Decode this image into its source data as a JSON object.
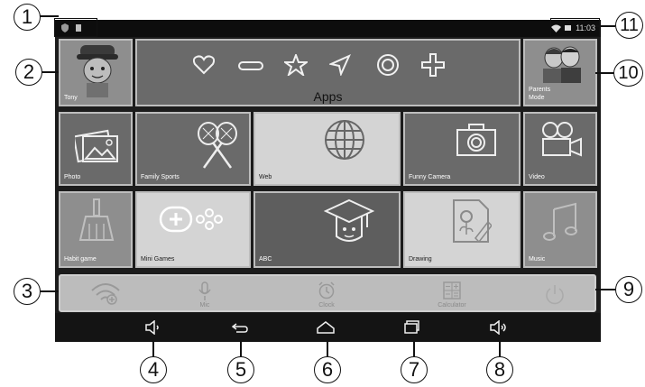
{
  "status_bar": {
    "time": "11:03",
    "left_icons": [
      "shield-icon",
      "battery-small-icon"
    ],
    "right_icons": [
      "wifi-icon",
      "battery-icon"
    ]
  },
  "profile": {
    "name": "Tony"
  },
  "apps_banner": {
    "label": "Apps"
  },
  "parents_mode": {
    "label": "Parents Mode"
  },
  "tiles": [
    {
      "label": "Photo"
    },
    {
      "label": "Family Sports"
    },
    {
      "label": "Web"
    },
    {
      "label": "Funny Camera"
    },
    {
      "label": "Video"
    },
    {
      "label": "Habit game"
    },
    {
      "label": "Mini Games"
    },
    {
      "label": "ABC"
    },
    {
      "label": "Drawing"
    },
    {
      "label": "Music"
    }
  ],
  "dock": {
    "wifi": {
      "label": ""
    },
    "mic": {
      "label": "Mic"
    },
    "clock": {
      "label": "Clock"
    },
    "calculator": {
      "label": "Calculator"
    },
    "power": {
      "label": ""
    }
  },
  "nav": [
    "volume-down-icon",
    "back-icon",
    "home-icon",
    "recent-apps-icon",
    "volume-up-icon"
  ],
  "callouts": {
    "c1": "1",
    "c2": "2",
    "c3": "3",
    "c4": "4",
    "c5": "5",
    "c6": "6",
    "c7": "7",
    "c8": "8",
    "c9": "9",
    "c10": "10",
    "c11": "11"
  }
}
